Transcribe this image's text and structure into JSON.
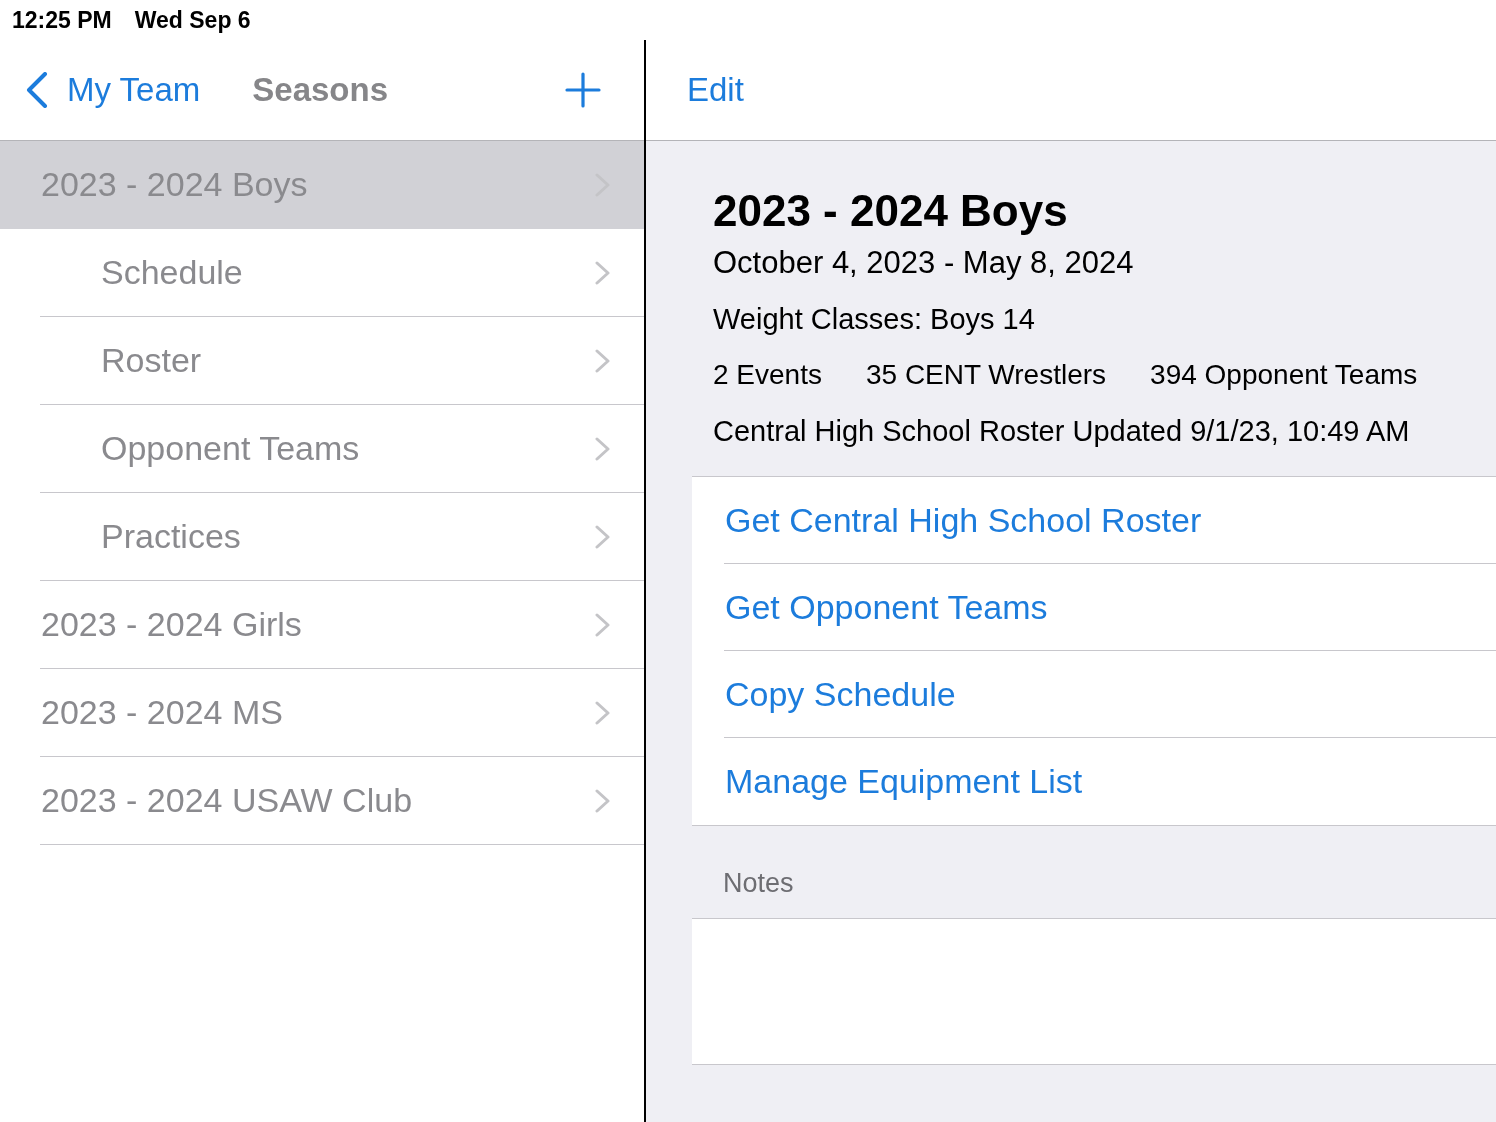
{
  "status_bar": {
    "time": "12:25 PM",
    "date": "Wed Sep 6"
  },
  "sidebar": {
    "back_label": "My Team",
    "title": "Seasons",
    "items": [
      {
        "label": "2023 - 2024 Boys",
        "selected": true,
        "children": [
          {
            "label": "Schedule",
            "selected": false
          },
          {
            "label": "Roster",
            "selected": false
          },
          {
            "label": "Opponent Teams",
            "selected": false
          },
          {
            "label": "Practices",
            "selected": false
          }
        ]
      },
      {
        "label": "2023 - 2024 Girls",
        "selected": false
      },
      {
        "label": "2023 - 2024 MS",
        "selected": false
      },
      {
        "label": "2023 - 2024 USAW Club",
        "selected": false
      }
    ]
  },
  "detail": {
    "edit_label": "Edit",
    "title": "2023 - 2024 Boys",
    "date_range": "October 4, 2023 - May 8, 2024",
    "weight_classes": "Weight Classes: Boys 14",
    "stats": [
      "2 Events",
      "35 CENT Wrestlers",
      "394 Opponent Teams"
    ],
    "roster_updated": "Central High School Roster Updated 9/1/23, 10:49 AM",
    "actions": [
      "Get Central High School Roster",
      "Get Opponent Teams",
      "Copy Schedule",
      "Manage Equipment List"
    ],
    "notes_label": "Notes"
  }
}
